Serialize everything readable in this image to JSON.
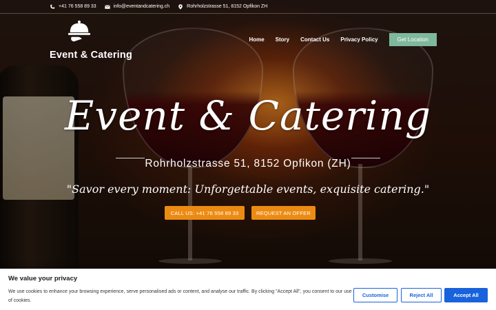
{
  "topbar": {
    "phone": "+41 76 558 89 33",
    "email": "info@eventandcatering.ch",
    "address": "Rohrholzstrasse 51, 8152 Opfikon ZH"
  },
  "header": {
    "logo_text": "Event & Catering",
    "nav": [
      {
        "label": "Home"
      },
      {
        "label": "Story"
      },
      {
        "label": "Contact Us"
      },
      {
        "label": "Privacy Policy"
      }
    ],
    "cta_label": "Get Location",
    "cta_color": "#7fb89c"
  },
  "hero": {
    "title": "Event & Catering",
    "address": "Rohrholzstrasse 51, 8152 Opfikon (ZH)",
    "quote": "\"Savor every moment: Unforgettable events, exquisite catering.\"",
    "call_button": "CALL US: +41 76 558 89 33",
    "offer_button": "REQUEST AN OFFER",
    "button_color": "#ec8b13"
  },
  "cookie": {
    "title": "We value your privacy",
    "text": "We use cookies to enhance your browsing experience, serve personalised ads or content, and analyse our traffic. By clicking \"Accept All\", you consent to our use of cookies.",
    "customise": "Customise",
    "reject": "Reject All",
    "accept": "Accept All",
    "accent_color": "#1863dc"
  },
  "icons": {
    "phone": "phone-icon",
    "email": "envelope-icon",
    "address": "map-pin-icon",
    "logo": "serving-cloche-icon"
  }
}
